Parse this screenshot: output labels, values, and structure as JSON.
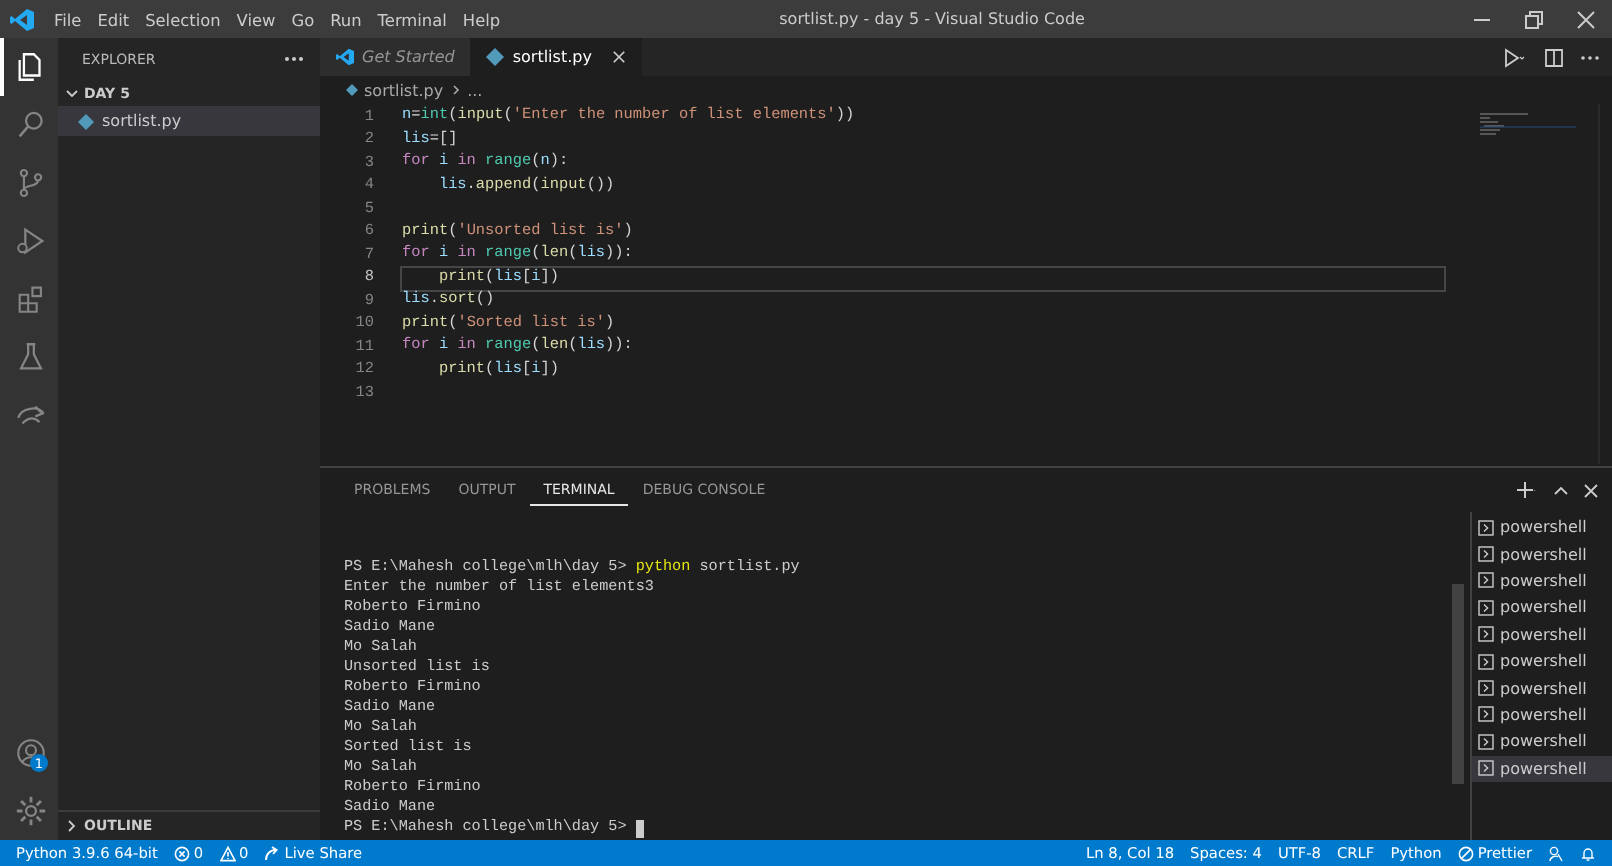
{
  "title_bar": {
    "menu": [
      "File",
      "Edit",
      "Selection",
      "View",
      "Go",
      "Run",
      "Terminal",
      "Help"
    ],
    "title": "sortlist.py - day 5 - Visual Studio Code"
  },
  "activity_bar": {
    "items": [
      {
        "kind": "explorer",
        "selected": true
      },
      {
        "kind": "search",
        "selected": false
      },
      {
        "kind": "source_control",
        "selected": false
      },
      {
        "kind": "run",
        "selected": false
      },
      {
        "kind": "extensions",
        "selected": false
      },
      {
        "kind": "testing",
        "selected": false
      },
      {
        "kind": "remote",
        "selected": false
      }
    ],
    "account_badge": "1"
  },
  "sidebar": {
    "title": "EXPLORER",
    "tree": [
      {
        "label": "DAY 5",
        "expanded": true,
        "children": [
          {
            "label": "sortlist.py",
            "selected": true
          }
        ]
      }
    ],
    "outline": {
      "label": "OUTLINE",
      "expanded": false
    }
  },
  "editor": {
    "tabs": [
      {
        "label": "Get Started",
        "kind": "welcome",
        "selected": false
      },
      {
        "label": "sortlist.py",
        "kind": "python",
        "selected": true
      }
    ],
    "breadcrumb": [
      "sortlist.py",
      "..."
    ],
    "lines": [
      {
        "number": "1",
        "current": false,
        "tokens": [
          {
            "text": "n",
            "kind": "variable"
          },
          {
            "text": "=",
            "kind": "plain"
          },
          {
            "text": "int",
            "kind": "class"
          },
          {
            "text": "(",
            "kind": "plain"
          },
          {
            "text": "input",
            "kind": "function"
          },
          {
            "text": "(",
            "kind": "plain"
          },
          {
            "text": "'Enter the number of list elements'",
            "kind": "string"
          },
          {
            "text": "))",
            "kind": "plain"
          }
        ]
      },
      {
        "number": "2",
        "current": false,
        "tokens": [
          {
            "text": "lis",
            "kind": "variable"
          },
          {
            "text": "=[]",
            "kind": "plain"
          }
        ]
      },
      {
        "number": "3",
        "current": false,
        "tokens": [
          {
            "text": "for",
            "kind": "keyword"
          },
          {
            "text": " i ",
            "kind": "variable"
          },
          {
            "text": "in",
            "kind": "keyword"
          },
          {
            "text": " range",
            "kind": "class"
          },
          {
            "text": "(",
            "kind": "plain"
          },
          {
            "text": "n",
            "kind": "variable"
          },
          {
            "text": "):",
            "kind": "plain"
          }
        ]
      },
      {
        "number": "4",
        "current": false,
        "tokens": [
          {
            "text": "    lis",
            "kind": "variable"
          },
          {
            "text": ".",
            "kind": "plain"
          },
          {
            "text": "append",
            "kind": "function"
          },
          {
            "text": "(",
            "kind": "plain"
          },
          {
            "text": "input",
            "kind": "function"
          },
          {
            "text": "())",
            "kind": "plain"
          }
        ]
      },
      {
        "number": "5",
        "current": false
      },
      {
        "number": "6",
        "current": false,
        "tokens": [
          {
            "text": "print",
            "kind": "function"
          },
          {
            "text": "(",
            "kind": "plain"
          },
          {
            "text": "'Unsorted list is'",
            "kind": "string"
          },
          {
            "text": ")",
            "kind": "plain"
          }
        ]
      },
      {
        "number": "7",
        "current": false,
        "tokens": [
          {
            "text": "for",
            "kind": "keyword"
          },
          {
            "text": " i ",
            "kind": "variable"
          },
          {
            "text": "in",
            "kind": "keyword"
          },
          {
            "text": " range",
            "kind": "class"
          },
          {
            "text": "(",
            "kind": "plain"
          },
          {
            "text": "len",
            "kind": "function"
          },
          {
            "text": "(",
            "kind": "plain"
          },
          {
            "text": "lis",
            "kind": "variable"
          },
          {
            "text": ")):",
            "kind": "plain"
          }
        ]
      },
      {
        "number": "8",
        "current": true,
        "tokens": [
          {
            "text": "    print",
            "kind": "function"
          },
          {
            "text": "(",
            "kind": "plain"
          },
          {
            "text": "lis",
            "kind": "variable"
          },
          {
            "text": "[",
            "kind": "plain"
          },
          {
            "text": "i",
            "kind": "variable"
          },
          {
            "text": "])",
            "kind": "plain"
          }
        ]
      },
      {
        "number": "9",
        "current": false,
        "tokens": [
          {
            "text": "lis",
            "kind": "variable"
          },
          {
            "text": ".",
            "kind": "plain"
          },
          {
            "text": "sort",
            "kind": "function"
          },
          {
            "text": "()",
            "kind": "plain"
          }
        ]
      },
      {
        "number": "10",
        "current": false,
        "tokens": [
          {
            "text": "print",
            "kind": "function"
          },
          {
            "text": "(",
            "kind": "plain"
          },
          {
            "text": "'Sorted list is'",
            "kind": "string"
          },
          {
            "text": ")",
            "kind": "plain"
          }
        ]
      },
      {
        "number": "11",
        "current": false,
        "tokens": [
          {
            "text": "for",
            "kind": "keyword"
          },
          {
            "text": " i ",
            "kind": "variable"
          },
          {
            "text": "in",
            "kind": "keyword"
          },
          {
            "text": " range",
            "kind": "class"
          },
          {
            "text": "(",
            "kind": "plain"
          },
          {
            "text": "len",
            "kind": "function"
          },
          {
            "text": "(",
            "kind": "plain"
          },
          {
            "text": "lis",
            "kind": "variable"
          },
          {
            "text": ")):",
            "kind": "plain"
          }
        ]
      },
      {
        "number": "12",
        "current": false,
        "tokens": [
          {
            "text": "    print",
            "kind": "function"
          },
          {
            "text": "(",
            "kind": "plain"
          },
          {
            "text": "lis",
            "kind": "variable"
          },
          {
            "text": "[",
            "kind": "plain"
          },
          {
            "text": "i",
            "kind": "variable"
          },
          {
            "text": "])",
            "kind": "plain"
          }
        ]
      },
      {
        "number": "13",
        "current": false
      }
    ]
  },
  "panel": {
    "tabs": [
      {
        "label": "PROBLEMS",
        "selected": false
      },
      {
        "label": "OUTPUT",
        "selected": false
      },
      {
        "label": "TERMINAL",
        "selected": true
      },
      {
        "label": "DEBUG CONSOLE",
        "selected": false
      }
    ],
    "terminal_lines": [
      {
        "cursor": false,
        "segments": [
          {
            "text": "PS E:\\Mahesh college\\mlh\\day 5> ",
            "kind": "plain"
          },
          {
            "text": "python",
            "kind": "command"
          },
          {
            "text": " sortlist.py",
            "kind": "plain"
          }
        ]
      },
      {
        "cursor": false,
        "segments": [
          {
            "text": "Enter the number of list elements3",
            "kind": "plain"
          }
        ]
      },
      {
        "cursor": false,
        "segments": [
          {
            "text": "Roberto Firmino",
            "kind": "plain"
          }
        ]
      },
      {
        "cursor": false,
        "segments": [
          {
            "text": "Sadio Mane",
            "kind": "plain"
          }
        ]
      },
      {
        "cursor": false,
        "segments": [
          {
            "text": "Mo Salah",
            "kind": "plain"
          }
        ]
      },
      {
        "cursor": false,
        "segments": [
          {
            "text": "Unsorted list is",
            "kind": "plain"
          }
        ]
      },
      {
        "cursor": false,
        "segments": [
          {
            "text": "Roberto Firmino",
            "kind": "plain"
          }
        ]
      },
      {
        "cursor": false,
        "segments": [
          {
            "text": "Sadio Mane",
            "kind": "plain"
          }
        ]
      },
      {
        "cursor": false,
        "segments": [
          {
            "text": "Mo Salah",
            "kind": "plain"
          }
        ]
      },
      {
        "cursor": false,
        "segments": [
          {
            "text": "Sorted list is",
            "kind": "plain"
          }
        ]
      },
      {
        "cursor": false,
        "segments": [
          {
            "text": "Mo Salah",
            "kind": "plain"
          }
        ]
      },
      {
        "cursor": false,
        "segments": [
          {
            "text": "Roberto Firmino",
            "kind": "plain"
          }
        ]
      },
      {
        "cursor": false,
        "segments": [
          {
            "text": "Sadio Mane",
            "kind": "plain"
          }
        ]
      },
      {
        "cursor": true,
        "segments": [
          {
            "text": "PS E:\\Mahesh college\\mlh\\day 5> ",
            "kind": "plain"
          }
        ]
      }
    ],
    "terminals": [
      {
        "label": "powershell",
        "selected": false
      },
      {
        "label": "powershell",
        "selected": false
      },
      {
        "label": "powershell",
        "selected": false
      },
      {
        "label": "powershell",
        "selected": false
      },
      {
        "label": "powershell",
        "selected": false
      },
      {
        "label": "powershell",
        "selected": false
      },
      {
        "label": "powershell",
        "selected": false
      },
      {
        "label": "powershell",
        "selected": false
      },
      {
        "label": "powershell",
        "selected": false
      },
      {
        "label": "powershell",
        "selected": true
      }
    ]
  },
  "status_bar": {
    "left": [
      {
        "kind": "interpreter",
        "text": "Python 3.9.6 64-bit"
      },
      {
        "kind": "errors",
        "text": "0"
      },
      {
        "kind": "warnings",
        "text": "0"
      },
      {
        "kind": "live_share",
        "text": "Live Share"
      }
    ],
    "right": [
      {
        "kind": "text",
        "text": "Ln 8, Col 18"
      },
      {
        "kind": "text",
        "text": "Spaces: 4"
      },
      {
        "kind": "text",
        "text": "UTF-8"
      },
      {
        "kind": "text",
        "text": "CRLF"
      },
      {
        "kind": "text",
        "text": "Python"
      },
      {
        "kind": "prettier",
        "text": "Prettier"
      },
      {
        "kind": "feedback"
      },
      {
        "kind": "bell"
      }
    ]
  }
}
